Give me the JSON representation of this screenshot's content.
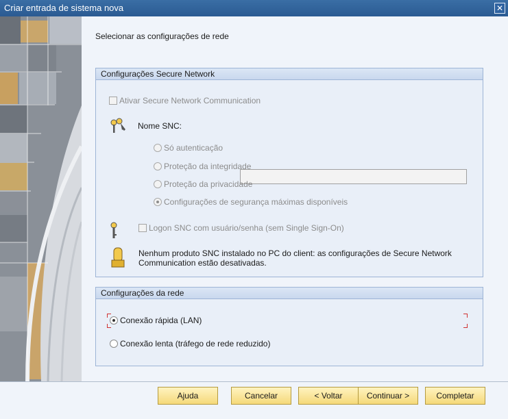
{
  "window": {
    "title": "Criar entrada de sistema nova"
  },
  "heading": "Selecionar as configurações de rede",
  "secure_network": {
    "title": "Configurações Secure Network",
    "activate_label": "Ativar Secure Network Communication",
    "snc_name_label": "Nome SNC:",
    "snc_name_value": "",
    "options": [
      {
        "label": "Só autenticação",
        "selected": false
      },
      {
        "label": "Proteção da integridade",
        "selected": false
      },
      {
        "label": "Proteção da privacidade",
        "selected": false
      },
      {
        "label": "Configurações de segurança máximas disponíveis",
        "selected": true
      }
    ],
    "logon_label": "Logon SNC com usuário/senha (sem Single Sign-On)",
    "warning_line1": "Nenhum produto SNC instalado no PC do client: as configurações de Secure Network",
    "warning_line2": "Communication estão desativadas."
  },
  "network": {
    "title": "Configurações da rede",
    "options": [
      {
        "label": "Conexão rápida (LAN)",
        "selected": true
      },
      {
        "label": "Conexão lenta (tráfego de rede reduzido)",
        "selected": false
      }
    ]
  },
  "buttons": {
    "help": "Ajuda",
    "cancel": "Cancelar",
    "back": "< Voltar",
    "next": "Continuar >",
    "finish": "Completar"
  },
  "colors": {
    "titlebar": "#2a5a92",
    "accent_button": "#f5d97a",
    "group_border": "#9db4d6"
  }
}
